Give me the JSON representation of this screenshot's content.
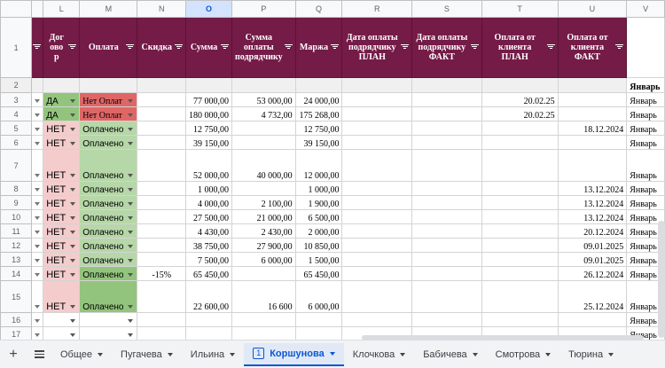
{
  "columns": [
    "L",
    "M",
    "N",
    "O",
    "P",
    "Q",
    "R",
    "S",
    "T",
    "U",
    "V"
  ],
  "selected_column": "O",
  "headers": {
    "L": "Дог\nово\nр",
    "M": "Оплата",
    "N": "Скидка",
    "O": "Сумма",
    "P": "Сумма оплаты подрядчику",
    "Q": "Маржа",
    "R": "Дата оплаты подрядчику ПЛАН",
    "S": "Дата оплаты подрядчику ФАКТ",
    "T": "Оплата от клиента ПЛАН",
    "U": "Оплата от клиента ФАКТ"
  },
  "row2": {
    "num": "2",
    "V": "Январь"
  },
  "rows": [
    {
      "num": "3",
      "L": "ДА",
      "M": "Нет Оплат",
      "N": "",
      "O": "77 000,00",
      "P": "53 000,00",
      "Q": "24 000,00",
      "R": "",
      "S": "",
      "T": "20.02.25",
      "U": "",
      "V": "Январь",
      "L_style": "green",
      "M_style": "red",
      "tall": false
    },
    {
      "num": "4",
      "L": "ДА",
      "M": "Нет Оплат",
      "N": "",
      "O": "180 000,00",
      "P": "4 732,00",
      "Q": "175 268,00",
      "R": "",
      "S": "",
      "T": "20.02.25",
      "U": "",
      "V": "Январь",
      "L_style": "green",
      "M_style": "red",
      "tall": false
    },
    {
      "num": "5",
      "L": "НЕТ",
      "M": "Оплачено",
      "N": "",
      "O": "12 750,00",
      "P": "",
      "Q": "12 750,00",
      "R": "",
      "S": "",
      "T": "",
      "U": "18.12.2024",
      "V": "Январь",
      "L_style": "pink",
      "M_style": "lgreen",
      "tall": false
    },
    {
      "num": "6",
      "L": "НЕТ",
      "M": "Оплачено",
      "N": "",
      "O": "39 150,00",
      "P": "",
      "Q": "39 150,00",
      "R": "",
      "S": "",
      "T": "",
      "U": "",
      "V": "Январь",
      "L_style": "pink",
      "M_style": "lgreen",
      "tall": false
    },
    {
      "num": "7",
      "L": "НЕТ",
      "M": "Оплачено",
      "N": "",
      "O": "52 000,00",
      "P": "40 000,00",
      "Q": "12 000,00",
      "R": "",
      "S": "",
      "T": "",
      "U": "",
      "V": "Январь",
      "L_style": "pink",
      "M_style": "lgreen",
      "tall": true
    },
    {
      "num": "8",
      "L": "НЕТ",
      "M": "Оплачено",
      "N": "",
      "O": "1 000,00",
      "P": "",
      "Q": "1 000,00",
      "R": "",
      "S": "",
      "T": "",
      "U": "13.12.2024",
      "V": "Январь",
      "L_style": "pink",
      "M_style": "lgreen",
      "tall": false
    },
    {
      "num": "9",
      "L": "НЕТ",
      "M": "Оплачено",
      "N": "",
      "O": "4 000,00",
      "P": "2 100,00",
      "Q": "1 900,00",
      "R": "",
      "S": "",
      "T": "",
      "U": "13.12.2024",
      "V": "Январь",
      "L_style": "pink",
      "M_style": "lgreen",
      "tall": false
    },
    {
      "num": "10",
      "L": "НЕТ",
      "M": "Оплачено",
      "N": "",
      "O": "27 500,00",
      "P": "21 000,00",
      "Q": "6 500,00",
      "R": "",
      "S": "",
      "T": "",
      "U": "13.12.2024",
      "V": "Январь",
      "L_style": "pink",
      "M_style": "lgreen",
      "tall": false
    },
    {
      "num": "11",
      "L": "НЕТ",
      "M": "Оплачено",
      "N": "",
      "O": "4 430,00",
      "P": "2 430,00",
      "Q": "2 000,00",
      "R": "",
      "S": "",
      "T": "",
      "U": "20.12.2024",
      "V": "Январь",
      "L_style": "pink",
      "M_style": "lgreen",
      "tall": false
    },
    {
      "num": "12",
      "L": "НЕТ",
      "M": "Оплачено",
      "N": "",
      "O": "38 750,00",
      "P": "27 900,00",
      "Q": "10 850,00",
      "R": "",
      "S": "",
      "T": "",
      "U": "09.01.2025",
      "V": "Январь",
      "L_style": "pink",
      "M_style": "lgreen",
      "tall": false
    },
    {
      "num": "13",
      "L": "НЕТ",
      "M": "Оплачено",
      "N": "",
      "O": "7 500,00",
      "P": "6 000,00",
      "Q": "1 500,00",
      "R": "",
      "S": "",
      "T": "",
      "U": "09.01.2025",
      "V": "Январь",
      "L_style": "pink",
      "M_style": "lgreen",
      "tall": false
    },
    {
      "num": "14",
      "L": "НЕТ",
      "M": "Оплачено",
      "N": "-15%",
      "O": "65 450,00",
      "P": "",
      "Q": "65 450,00",
      "R": "",
      "S": "",
      "T": "",
      "U": "26.12.2024",
      "V": "Январь",
      "L_style": "pink",
      "M_style": "green",
      "tall": false
    },
    {
      "num": "15",
      "L": "НЕТ",
      "M": "Оплачено",
      "N": "",
      "O": "22 600,00",
      "P": "16 600",
      "Q": "6 000,00",
      "R": "",
      "S": "",
      "T": "",
      "U": "25.12.2024",
      "V": "Январь",
      "L_style": "pink",
      "M_style": "green",
      "tall": true
    },
    {
      "num": "16",
      "L": "",
      "M": "",
      "N": "",
      "O": "",
      "P": "",
      "Q": "",
      "R": "",
      "S": "",
      "T": "",
      "U": "",
      "V": "Январь",
      "L_style": "none",
      "M_style": "none",
      "tall": false
    },
    {
      "num": "17",
      "L": "",
      "M": "",
      "N": "",
      "O": "",
      "P": "",
      "Q": "",
      "R": "",
      "S": "",
      "T": "",
      "U": "",
      "V": "Январь",
      "L_style": "none",
      "M_style": "none",
      "tall": false
    }
  ],
  "header_row_num": "1",
  "tabs": [
    {
      "label": "Общее",
      "active": false
    },
    {
      "label": "Пугачева",
      "active": false
    },
    {
      "label": "Ильина",
      "active": false
    },
    {
      "label": "Коршунова",
      "active": true,
      "badge": "1"
    },
    {
      "label": "Клочкова",
      "active": false
    },
    {
      "label": "Бабичева",
      "active": false
    },
    {
      "label": "Смотрова",
      "active": false
    },
    {
      "label": "Тюрина",
      "active": false
    }
  ],
  "colors": {
    "header_bg": "#741b47",
    "green": "#93c47d",
    "pink": "#f4cccc",
    "red": "#e06666",
    "light_green": "#b6d7a8"
  }
}
